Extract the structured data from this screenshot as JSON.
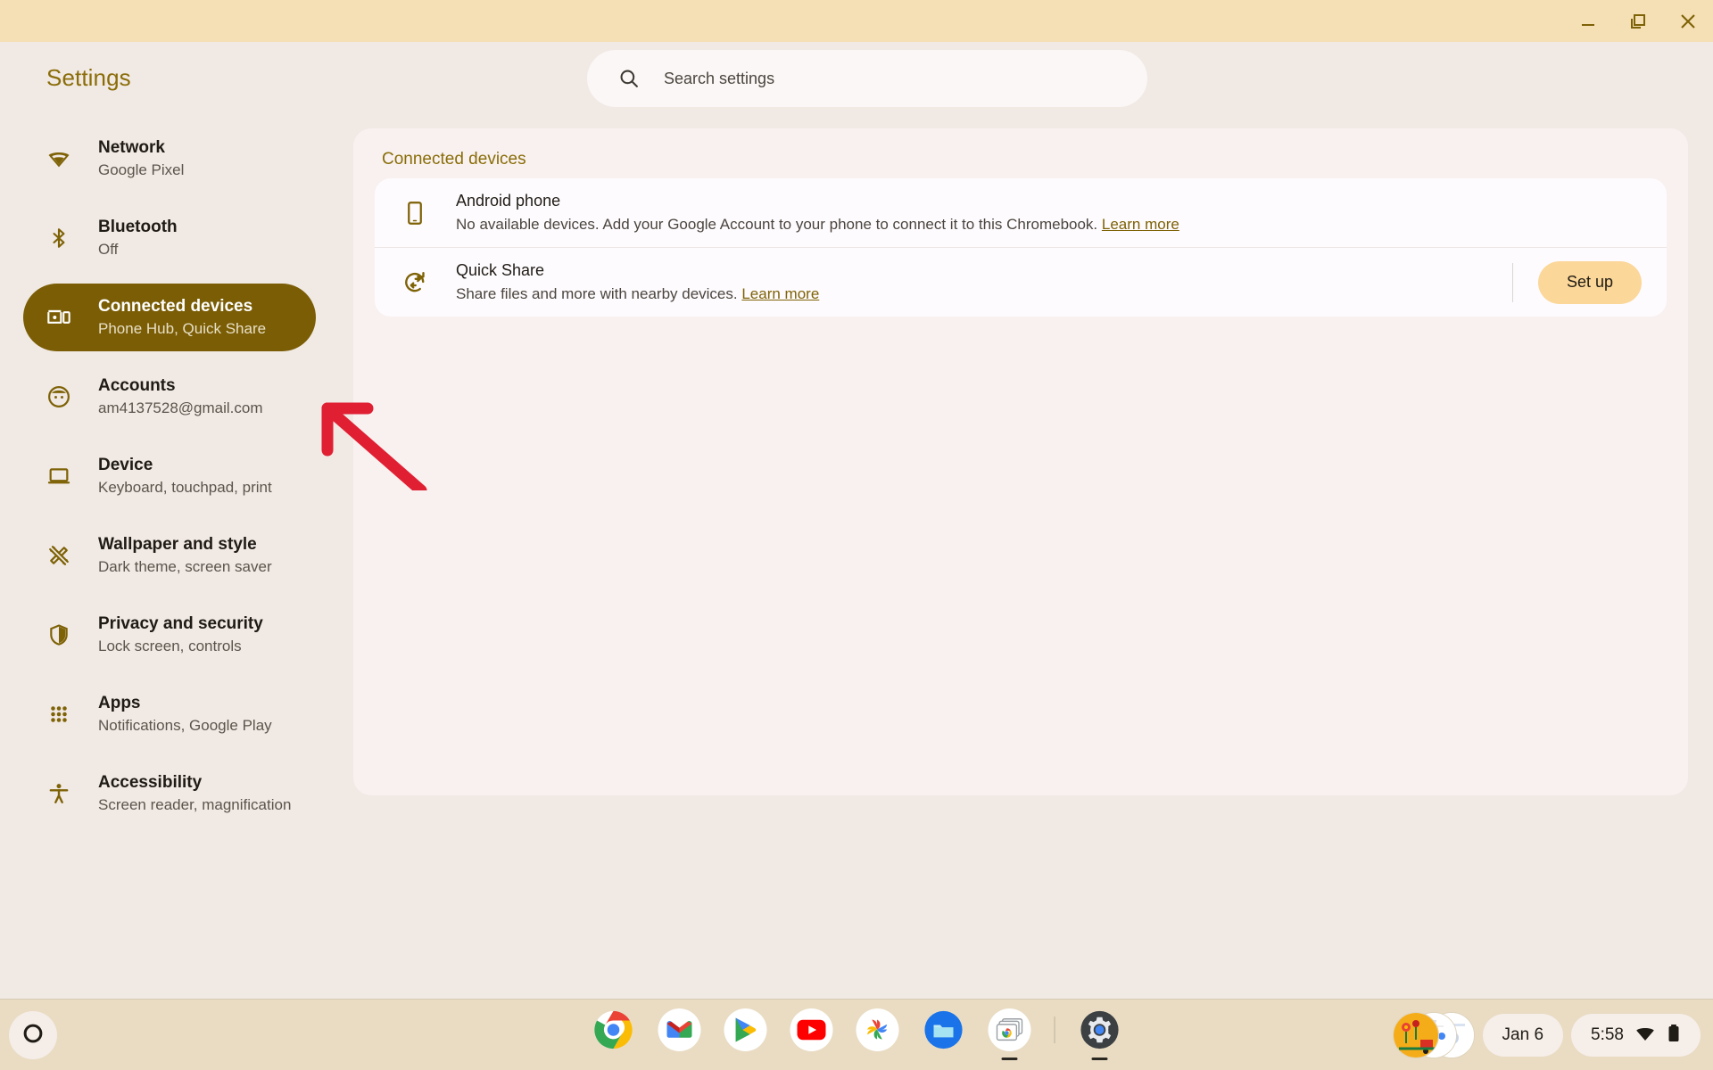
{
  "window": {
    "controls": [
      {
        "name": "minimize",
        "label": "Minimize"
      },
      {
        "name": "restore",
        "label": "Restore"
      },
      {
        "name": "close",
        "label": "Close"
      }
    ],
    "titlebar_color": "#F5DFB4"
  },
  "header": {
    "app_title": "Settings",
    "title_color": "#8A6D08"
  },
  "search": {
    "placeholder": "Search settings",
    "value": "",
    "icon": "search-icon"
  },
  "sidebar": {
    "selected_index": 2,
    "selected_bg": "#7A5D05",
    "icon_color": "#7E6206",
    "items": [
      {
        "icon": "wifi-icon",
        "label": "Network",
        "sublabel": "Google Pixel"
      },
      {
        "icon": "bluetooth-icon",
        "label": "Bluetooth",
        "sublabel": "Off"
      },
      {
        "icon": "connected-devices-icon",
        "label": "Connected devices",
        "sublabel": "Phone Hub, Quick Share"
      },
      {
        "icon": "account-icon",
        "label": "Accounts",
        "sublabel": "am4137528@gmail.com"
      },
      {
        "icon": "laptop-icon",
        "label": "Device",
        "sublabel": "Keyboard, touchpad, print"
      },
      {
        "icon": "brush-ruler-icon",
        "label": "Wallpaper and style",
        "sublabel": "Dark theme, screen saver"
      },
      {
        "icon": "shield-icon",
        "label": "Privacy and security",
        "sublabel": "Lock screen, controls"
      },
      {
        "icon": "apps-grid-icon",
        "label": "Apps",
        "sublabel": "Notifications, Google Play"
      },
      {
        "icon": "accessibility-icon",
        "label": "Accessibility",
        "sublabel": "Screen reader, magnification"
      }
    ]
  },
  "main": {
    "section_title": "Connected devices",
    "section_title_color": "#8A6D08",
    "rows": [
      {
        "icon": "android-phone-icon",
        "title": "Android phone",
        "description": "No available devices. Add your Google Account to your phone to connect it to this Chromebook.",
        "link_text": "Learn more",
        "action": null
      },
      {
        "icon": "quick-share-icon",
        "title": "Quick Share",
        "description": "Share files and more with nearby devices.",
        "link_text": "Learn more",
        "action": "Set up"
      }
    ],
    "setup_button_color": "#FBD79A"
  },
  "annotation": {
    "type": "arrow",
    "color": "#E01F33",
    "points_to": "sidebar-item-connected-devices"
  },
  "shelf": {
    "launcher_icon": "launcher-circle-icon",
    "apps": [
      {
        "name": "chrome",
        "label": "Chrome",
        "running": false
      },
      {
        "name": "gmail",
        "label": "Gmail",
        "running": false
      },
      {
        "name": "play-store",
        "label": "Play Store",
        "running": false
      },
      {
        "name": "youtube",
        "label": "YouTube",
        "running": false
      },
      {
        "name": "photos",
        "label": "Photos",
        "running": false
      },
      {
        "name": "files",
        "label": "Files",
        "running": false
      },
      {
        "name": "screen-capture",
        "label": "Screen Capture",
        "running": true
      },
      {
        "name": "settings",
        "label": "Settings",
        "running": true
      }
    ],
    "status": {
      "date": "Jan 6",
      "time": "5:58",
      "wifi_icon": "wifi-full-icon",
      "battery_icon": "battery-icon"
    }
  }
}
